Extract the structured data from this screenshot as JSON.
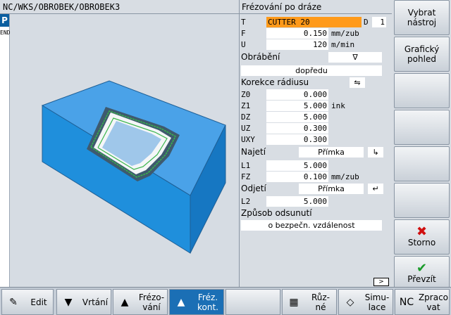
{
  "title": "NC/WKS/OBROBEK/OBROBEK3",
  "left_strip": {
    "p": "P",
    "end": "END"
  },
  "panel": {
    "header": "Frézování po dráze",
    "t": {
      "label": "T",
      "value": "CUTTER 20",
      "d_label": "D",
      "d_value": "1"
    },
    "f": {
      "label": "F",
      "value": "0.150",
      "unit": "mm/zub"
    },
    "u": {
      "label": "U",
      "value": "120",
      "unit": "m/min"
    },
    "obrabeni": {
      "label": "Obrábění",
      "icon": "∇"
    },
    "dopredu": "dopředu",
    "korekce": {
      "label": "Korekce rádiusu"
    },
    "z0": {
      "label": "Z0",
      "value": "0.000"
    },
    "z1": {
      "label": "Z1",
      "value": "5.000",
      "unit": "ink"
    },
    "dz": {
      "label": "DZ",
      "value": "5.000"
    },
    "uz": {
      "label": "UZ",
      "value": "0.300"
    },
    "uxy": {
      "label": "UXY",
      "value": "0.300"
    },
    "najeti": {
      "label": "Najetí",
      "value": "Přímka"
    },
    "l1": {
      "label": "L1",
      "value": "5.000"
    },
    "fz": {
      "label": "FZ",
      "value": "0.100",
      "unit": "mm/zub"
    },
    "odjeti": {
      "label": "Odjetí",
      "value": "Přímka"
    },
    "l2": {
      "label": "L2",
      "value": "5.000"
    },
    "zpusob": {
      "label": "Způsob odsunutí",
      "value": "o bezpečn. vzdálenost"
    }
  },
  "softkeys": {
    "vybrat": "Vybrat nástroj",
    "graficky": "Grafický pohled",
    "storno": "Storno",
    "prevzit": "Převzít"
  },
  "hkeys": {
    "edit": "Edit",
    "vrtani": "Vrtání",
    "frezovani": "Frézo- vání",
    "frez_kont": "Fréz. kont.",
    "ruzne": "Růz- né",
    "simulace": "Simu- lace",
    "zpracovat": "Zpraco vat"
  },
  "scroll_arrow": ">",
  "colors": {
    "accent": "#ff9a1a",
    "active": "#1b6fb5",
    "block": "#1f9ae0"
  }
}
